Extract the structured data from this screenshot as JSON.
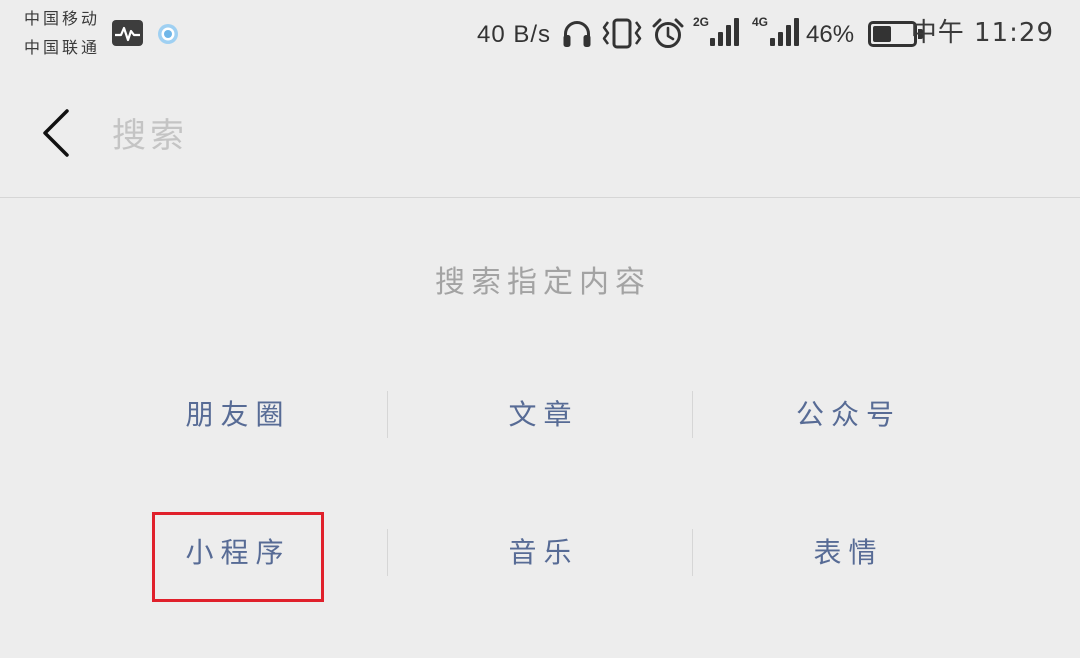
{
  "status_bar": {
    "carrier_1": "中国移动",
    "carrier_2": "中国联通",
    "net_speed": "40 B/s",
    "sim_1_network": "2G",
    "sim_2_network": "4G",
    "battery_label": "46%",
    "battery_level": 0.46,
    "time": "中午 11:29",
    "icons": {
      "activity": "activity-monitor-icon",
      "app": "app-notification-icon",
      "headphones": "headphones-icon",
      "vibrate": "vibrate-icon",
      "alarm": "alarm-icon",
      "signal": "signal-bars-icon",
      "battery": "battery-icon"
    }
  },
  "header": {
    "back_icon": "chevron-left-icon",
    "search_placeholder": "搜索"
  },
  "search_hint": "搜索指定内容",
  "categories": {
    "rows": [
      [
        {
          "label": "朋友圈",
          "highlighted": false
        },
        {
          "label": "文章",
          "highlighted": false
        },
        {
          "label": "公众号",
          "highlighted": false
        }
      ],
      [
        {
          "label": "小程序",
          "highlighted": true
        },
        {
          "label": "音乐",
          "highlighted": false
        },
        {
          "label": "表情",
          "highlighted": false
        }
      ]
    ]
  },
  "colors": {
    "background": "#ededed",
    "link": "#576b95",
    "hint": "#a3a3a3",
    "placeholder": "#c4c4c4",
    "highlight": "#e0202b"
  }
}
